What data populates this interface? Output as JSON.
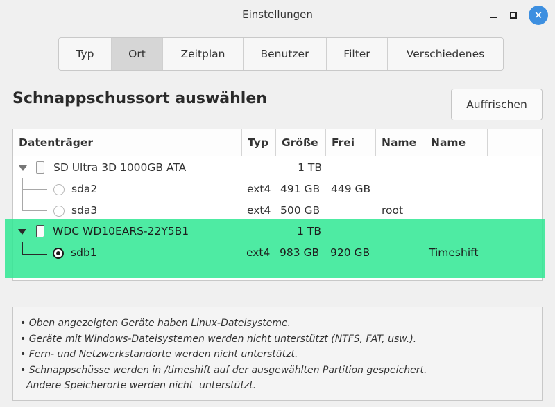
{
  "window": {
    "title": "Einstellungen"
  },
  "tabs": [
    {
      "label": "Typ",
      "active": false
    },
    {
      "label": "Ort",
      "active": true
    },
    {
      "label": "Zeitplan",
      "active": false
    },
    {
      "label": "Benutzer",
      "active": false
    },
    {
      "label": "Filter",
      "active": false
    },
    {
      "label": "Verschiedenes",
      "active": false
    }
  ],
  "main": {
    "heading": "Schnappschussort auswählen",
    "refresh_label": "Auffrischen"
  },
  "table": {
    "columns": [
      "Datenträger",
      "Typ",
      "Größe",
      "Frei",
      "Name",
      "Name"
    ],
    "rows": [
      {
        "device": "SD Ultra 3D 1000GB ATA",
        "type": "",
        "size": "1 TB",
        "free": "",
        "name1": "",
        "name2": "",
        "kind": "disk"
      },
      {
        "device": "sda2",
        "type": "ext4",
        "size": "491 GB",
        "free": "449 GB",
        "name1": "",
        "name2": "",
        "kind": "partition"
      },
      {
        "device": "sda3",
        "type": "ext4",
        "size": "500 GB",
        "free": "",
        "name1": "root",
        "name2": "",
        "kind": "partition"
      },
      {
        "device": "WDC WD10EARS-22Y5B1",
        "type": "",
        "size": "1 TB",
        "free": "",
        "name1": "",
        "name2": "",
        "kind": "disk"
      },
      {
        "device": "sdb1",
        "type": "ext4",
        "size": "983 GB",
        "free": "920 GB",
        "name1": "",
        "name2": "Timeshift",
        "kind": "partition",
        "selected": true
      }
    ]
  },
  "highlight_color": "#2fe893",
  "notes": [
    "• Oben angezeigten Geräte haben Linux-Dateisysteme.",
    "• Geräte mit Windows-Dateisystemen werden nicht unterstützt (NTFS, FAT, usw.).",
    "• Fern- und Netzwerkstandorte werden nicht unterstützt.",
    "• Schnappschüsse werden in /timeshift auf der ausgewählten Partition gespeichert.",
    "  Andere Speicherorte werden nicht  unterstützt."
  ],
  "icons": {
    "minimize": "minimize-icon",
    "maximize": "maximize-icon",
    "close": "close-icon",
    "disk": "disk-icon",
    "expander": "chevron-down-icon",
    "radio": "radio-icon"
  }
}
